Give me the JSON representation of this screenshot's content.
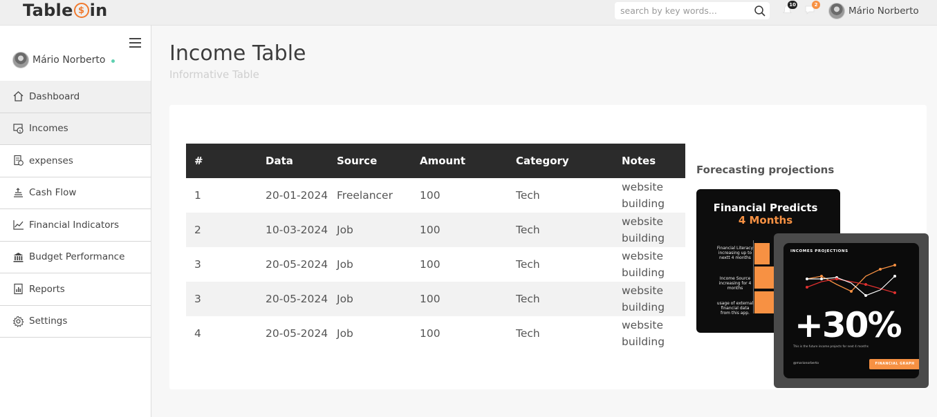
{
  "app": {
    "logo_pre": "Table",
    "logo_coin": "$",
    "logo_post": "in"
  },
  "topbar": {
    "search_placeholder": "search by key words...",
    "notifications_count": "10",
    "messages_count": "2",
    "user_name": "Mário Norberto"
  },
  "sidebar": {
    "user_name": "Mário Norberto",
    "items": [
      {
        "label": "Dashboard",
        "icon": "home-icon"
      },
      {
        "label": "Incomes",
        "icon": "income-icon"
      },
      {
        "label": "expenses",
        "icon": "expenses-icon"
      },
      {
        "label": "Cash Flow",
        "icon": "cash-flow-icon"
      },
      {
        "label": "Financial Indicators",
        "icon": "chart-line-icon"
      },
      {
        "label": "Budget Performance",
        "icon": "bank-icon"
      },
      {
        "label": "Reports",
        "icon": "report-icon"
      },
      {
        "label": "Settings",
        "icon": "gear-icon"
      }
    ]
  },
  "page": {
    "title": "Income Table",
    "subtitle": "Informative Table"
  },
  "table": {
    "headers": [
      "#",
      "Data",
      "Source",
      "Amount",
      "Category",
      "Notes"
    ],
    "rows": [
      [
        "1",
        "20-01-2024",
        "Freelancer",
        "100",
        "Tech",
        "website building"
      ],
      [
        "2",
        "10-03-2024",
        "Job",
        "100",
        "Tech",
        "website building"
      ],
      [
        "3",
        "20-05-2024",
        "Job",
        "100",
        "Tech",
        "website building"
      ],
      [
        "3",
        "20-05-2024",
        "Job",
        "100",
        "Tech",
        "website building"
      ],
      [
        "4",
        "20-05-2024",
        "Job",
        "100",
        "Tech",
        "website building"
      ]
    ]
  },
  "forecast": {
    "title": "Forecasting projections",
    "card1": {
      "heading": "Financial Predicts",
      "heading2": "4 Months",
      "notes": [
        "Financial Literacy increasing up to nextt 4 months",
        "Income Source increasing for 4 months",
        "usage of external financial data from this app."
      ]
    },
    "card2": {
      "label": "INCOMES PROJECTIONS",
      "big": "+30%",
      "small": "This is the future income projects for next 4 months",
      "handle": "@marionorberto",
      "button": "FINANCIAL GRAPH"
    }
  },
  "colors": {
    "accent": "#f79143",
    "dark": "#2b2b2b",
    "online": "#5fd0b0"
  }
}
